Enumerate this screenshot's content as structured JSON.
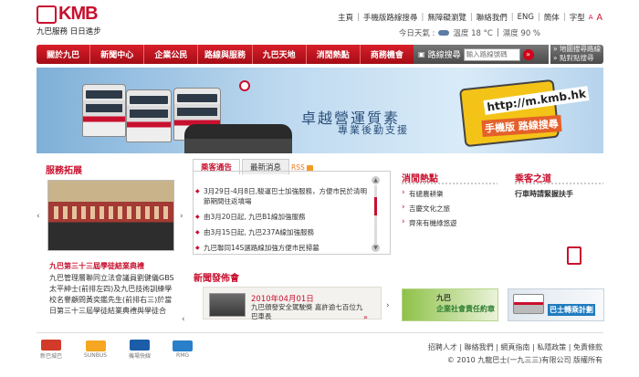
{
  "header": {
    "logo_text": "KMB",
    "logo_tagline": "九巴服務 日日進步",
    "top_links": [
      "主頁",
      "手機版路線搜尋",
      "無障礙瀏覽",
      "聯絡我們",
      "ENG",
      "簡体"
    ],
    "font_size_label": "字型",
    "font_size_small": "A",
    "font_size_large": "A",
    "weather_label": "今日天氣 :",
    "temperature": "溫度 18 °C",
    "humidity": "濕度 90 %"
  },
  "nav": {
    "items": [
      "關於九巴",
      "新聞中心",
      "企業公民",
      "路線與服務",
      "九巴天地",
      "消閒熱點",
      "商務機會"
    ],
    "route_search_label": "路線搜尋",
    "route_input_placeholder": "輸入路線號碼",
    "go_label": "»",
    "side_links": [
      "» 地圖搜尋路線",
      "» 點對點搜尋"
    ]
  },
  "banner": {
    "slogan_main": "卓越營運質素",
    "slogan_sub": "專業後勤支援",
    "mobile_url": "http://m.kmb.hk",
    "mobile_label": "手機版 路線搜尋"
  },
  "service_expansion": {
    "title": "服務拓展",
    "caption": "九巴第三十三屆學徒結業典禮",
    "body": "九巴管理層聯同立法會議員劉健儀GBS太平紳士(前排左四)及九巴技術訓練學校名譽顧問黃奕鑑先生(前排右三)於當日第三十三屆學徒結業典禮與學徒合"
  },
  "news": {
    "tabs": [
      "乘客通告",
      "最新消息"
    ],
    "rss_label": "RSS",
    "items": [
      "3月29日-4月8日,駿運巴士加強服務，方便市民於清明節期間往返墳場",
      "由3月20日起, 九巴B1線加強服務",
      "由3月15日起, 九巴237A線加強服務",
      "九巴聯同14S選路線加強方便市民掃墓"
    ]
  },
  "press": {
    "title": "新聞發佈會",
    "date": "2010年04月01日",
    "body": "九巴頒發安全駕駛獎 嘉許逾七百位九巴車長"
  },
  "leisure": {
    "title": "消閒熱點",
    "items": [
      "有總農耕樂",
      "吉慶文化之旅",
      "齊來有機綠悠遊"
    ]
  },
  "passenger_manners": {
    "title": "乘客之道",
    "subtitle": "行車時請緊握扶手"
  },
  "promos": {
    "csr_line1": "九巴",
    "csr_line2": "企業社會責任約章",
    "bbi_label": "巴士轉乘計劃"
  },
  "partners": [
    "新巴城巴",
    "SUNBUS",
    "機場快線",
    "RMG"
  ],
  "footer": {
    "links": "招聘人才 | 聯絡我們 | 網頁指南 | 私隱政策 | 免責條款",
    "copyright": "© 2010 九龍巴士(一九三三)有限公司 版權所有"
  },
  "colors": {
    "brand_red": "#c8102e",
    "nav_gray": "#555555",
    "accent_orange": "#e5602a"
  }
}
